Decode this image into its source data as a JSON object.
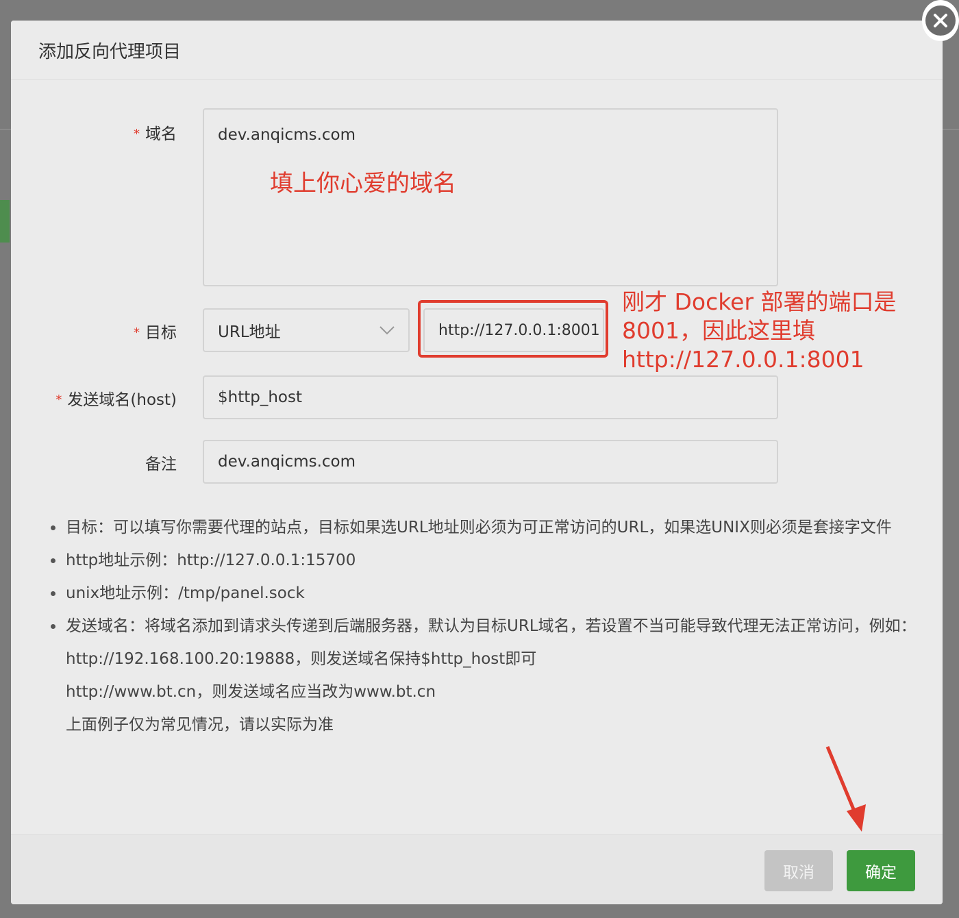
{
  "dialog": {
    "title": "添加反向代理项目",
    "close_icon": "close-circle-icon"
  },
  "form": {
    "domain": {
      "label": "域名",
      "value": "dev.anqicms.com"
    },
    "target": {
      "label": "目标",
      "type_value": "URL地址",
      "url_value": "http://127.0.0.1:8001",
      "dropdown_icon": "chevron-down-icon"
    },
    "host": {
      "label": "发送域名(host)",
      "value": "$http_host"
    },
    "remark": {
      "label": "备注",
      "value": "dev.anqicms.com"
    },
    "required_mark": "*"
  },
  "annotations": {
    "domain_hint": "填上你心爱的域名",
    "target_hint_lines": [
      "刚才 Docker 部署的端口是",
      "8001，因此这里填",
      "http://127.0.0.1:8001"
    ],
    "color": "#e03c2e"
  },
  "notes": [
    "目标：可以填写你需要代理的站点，目标如果选URL地址则必须为可正常访问的URL，如果选UNIX则必须是套接字文件",
    "http地址示例：http://127.0.0.1:15700",
    "unix地址示例：/tmp/panel.sock",
    "发送域名：将域名添加到请求头传递到后端服务器，默认为目标URL域名，若设置不当可能导致代理无法正常访问，例如："
  ],
  "note_extras": [
    "http://192.168.100.20:19888，则发送域名保持$http_host即可",
    "http://www.bt.cn，则发送域名应当改为www.bt.cn",
    "上面例子仅为常见情况，请以实际为准"
  ],
  "footer": {
    "cancel_label": "取消",
    "confirm_label": "确定",
    "confirm_color": "#3e9a3e"
  }
}
